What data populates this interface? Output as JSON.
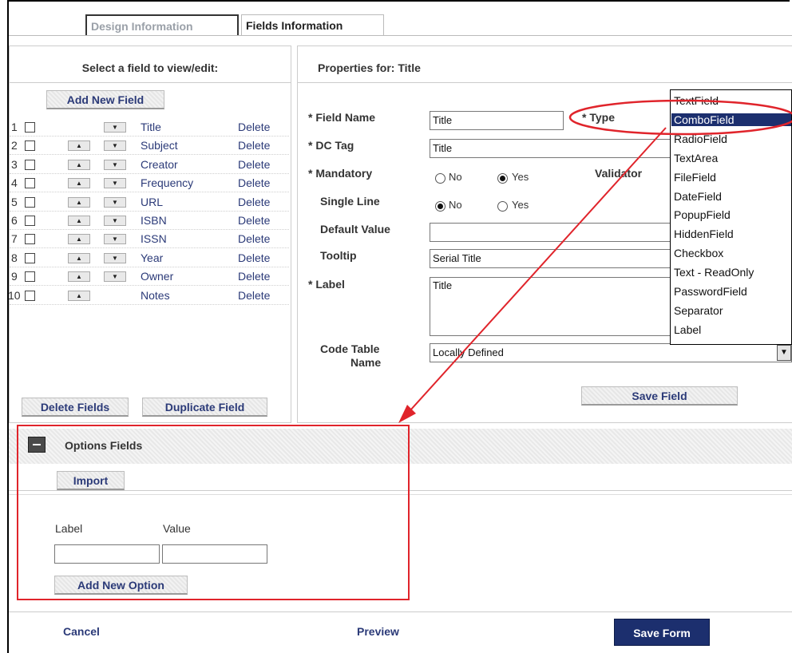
{
  "tabs": {
    "design": "Design Information",
    "fields": "Fields Information"
  },
  "left_panel": {
    "header": "Select a field to view/edit:",
    "add_new_field": "Add New Field",
    "rows": [
      {
        "num": "1",
        "name": "Title",
        "delete": "Delete"
      },
      {
        "num": "2",
        "name": "Subject",
        "delete": "Delete"
      },
      {
        "num": "3",
        "name": "Creator",
        "delete": "Delete"
      },
      {
        "num": "4",
        "name": "Frequency",
        "delete": "Delete"
      },
      {
        "num": "5",
        "name": "URL",
        "delete": "Delete"
      },
      {
        "num": "6",
        "name": "ISBN",
        "delete": "Delete"
      },
      {
        "num": "7",
        "name": "ISSN",
        "delete": "Delete"
      },
      {
        "num": "8",
        "name": "Year",
        "delete": "Delete"
      },
      {
        "num": "9",
        "name": "Owner",
        "delete": "Delete"
      },
      {
        "num": "10",
        "name": "Notes",
        "delete": "Delete"
      }
    ],
    "delete_fields": "Delete Fields",
    "duplicate_field": "Duplicate Field"
  },
  "properties": {
    "header": "Properties for: Title",
    "field_name_label": "* Field Name",
    "field_name_value": "Title",
    "type_label": "* Type",
    "dc_tag_label": "* DC Tag",
    "dc_tag_value": "Title",
    "mandatory_label": "* Mandatory",
    "mandatory_no": "No",
    "mandatory_yes": "Yes",
    "mandatory_selected": "Yes",
    "validator_label": "Validator",
    "single_line_label": "Single Line",
    "single_line_no": "No",
    "single_line_yes": "Yes",
    "single_line_selected": "No",
    "default_value_label": "Default Value",
    "default_value": "",
    "tooltip_label": "Tooltip",
    "tooltip_value": "Serial Title",
    "label_label": "* Label",
    "label_value": "Title",
    "code_table_label_1": "Code Table",
    "code_table_label_2": "Name",
    "code_table_value": "Locally Defined",
    "save_field": "Save Field"
  },
  "type_dropdown": {
    "options": [
      "TextField",
      "ComboField",
      "RadioField",
      "TextArea",
      "FileField",
      "DateField",
      "PopupField",
      "HiddenField",
      "Checkbox",
      "Text - ReadOnly",
      "PasswordField",
      "Separator",
      "Label"
    ],
    "selected": "ComboField"
  },
  "options_section": {
    "title": "Options Fields",
    "import": "Import",
    "label_header": "Label",
    "value_header": "Value",
    "label_input": "",
    "value_input": "",
    "add_new_option": "Add New Option"
  },
  "footer": {
    "cancel": "Cancel",
    "preview": "Preview",
    "save_form": "Save Form"
  },
  "colors": {
    "link": "#2b3a78",
    "selected_bg": "#1c2f6e",
    "annotation_red": "#e0242b",
    "save_form_bg": "#1c2f6e"
  }
}
